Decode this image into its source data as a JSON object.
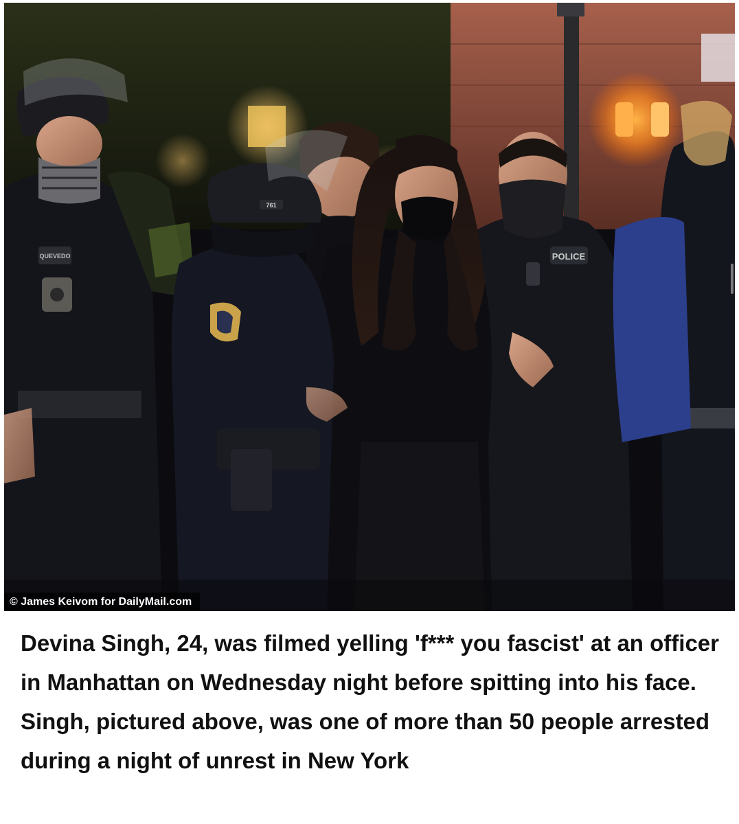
{
  "photo": {
    "credit": "© James Keivom for DailyMail.com",
    "badges": {
      "helmet_number": "761",
      "name_tag": "QUEVEDO",
      "jacket_text": "POLICE"
    }
  },
  "caption": "Devina Singh, 24, was filmed yelling 'f*** you fascist' at an officer in Manhattan on Wednesday night before spitting into his face. Singh, pictured above, was one of more than 50 people arrested during a night of unrest in New York",
  "colors": {
    "background": "#ffffff",
    "caption_text": "#111111",
    "credit_text": "#ffffff",
    "traffic_signal": "#ff9a2e"
  },
  "icons": [
    "scrollbar-thumb"
  ]
}
